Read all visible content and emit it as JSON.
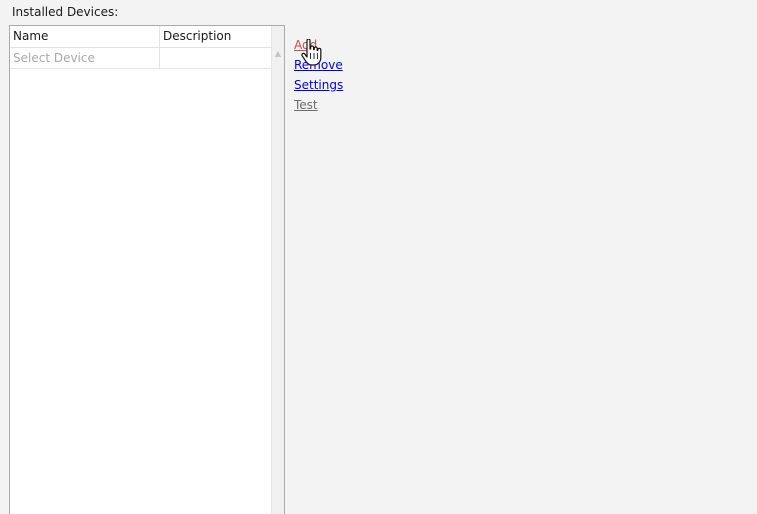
{
  "installed_devices_label": "Installed Devices:",
  "device_list": {
    "columns": [
      "Name",
      "Description"
    ],
    "rows": [
      {
        "name": "Select Device",
        "description": ""
      }
    ]
  },
  "actions": {
    "add": "Add",
    "remove": "Remove",
    "settings": "Settings",
    "test": "Test"
  },
  "colors": {
    "link": "#0000ee",
    "link_hover": "#c0504d",
    "link_disabled": "#6d6d6d",
    "placeholder": "#a8a8a8"
  },
  "cursor_icon": "hand-pointer-icon"
}
